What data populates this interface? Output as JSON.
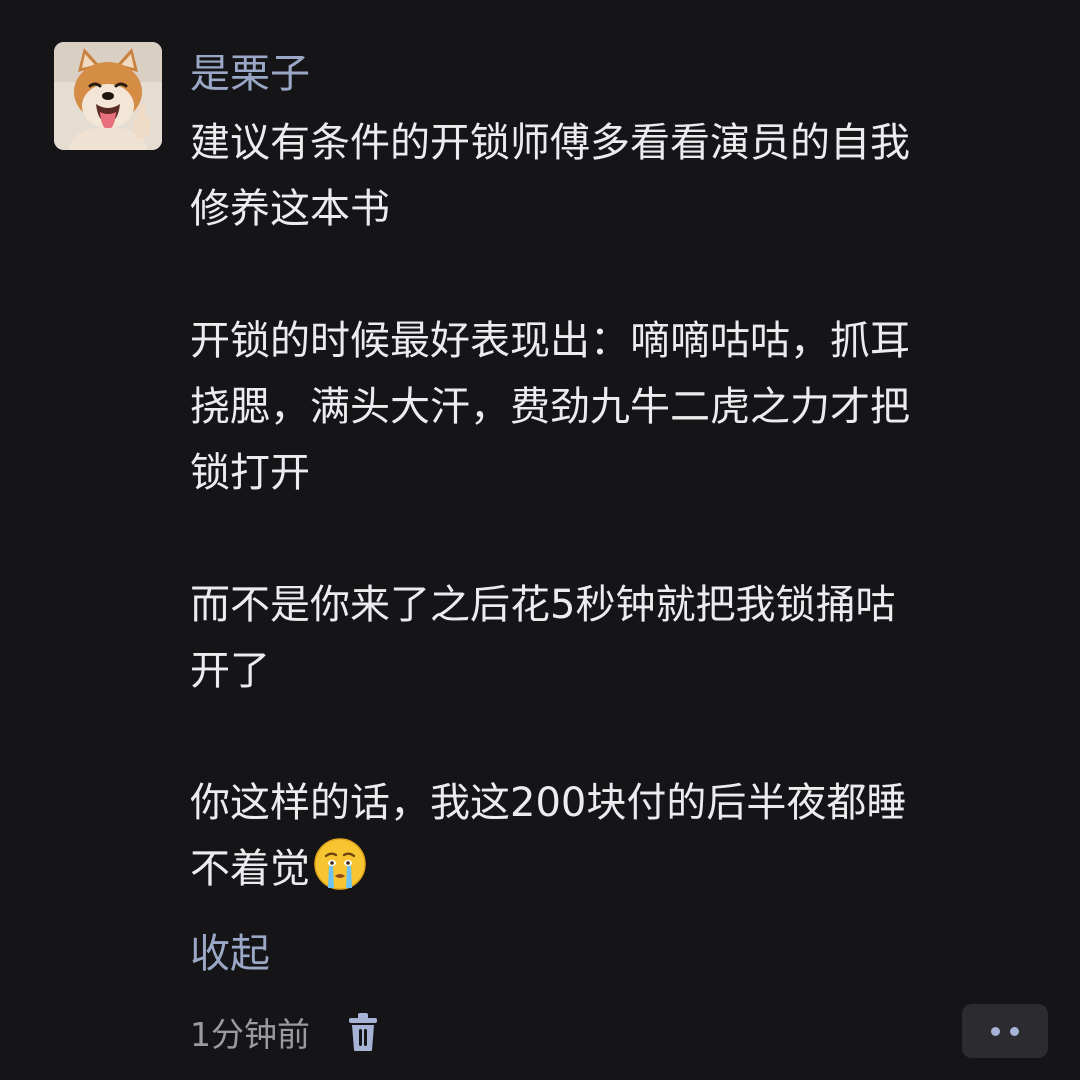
{
  "comment": {
    "username": "是栗子",
    "avatar_icon": "shiba-dog-thumbs-up-avatar",
    "paragraphs": [
      [
        "建议有条件的开锁师傅多看看演员的自我",
        "修养这本书"
      ],
      [
        "开锁的时候最好表现出：嘀嘀咕咕，抓耳",
        "挠腮，满头大汗，费劲九牛二虎之力才把",
        "锁打开"
      ],
      [
        "而不是你来了之后花5秒钟就把我锁捅咕",
        "开了"
      ],
      [
        "你这样的话，我这200块付的后半夜都睡",
        "不着觉"
      ]
    ],
    "trailing_emoji": "crying-face-icon",
    "collapse_label": "收起",
    "timestamp": "1分钟前",
    "delete_icon": "trash-icon",
    "more_icon": "more-dots-icon"
  },
  "colors": {
    "background": "#151417",
    "text": "#ececee",
    "accent_link": "#9aa7c6",
    "meta_text": "#9a9a9f",
    "more_button_bg": "#2b2b30"
  }
}
